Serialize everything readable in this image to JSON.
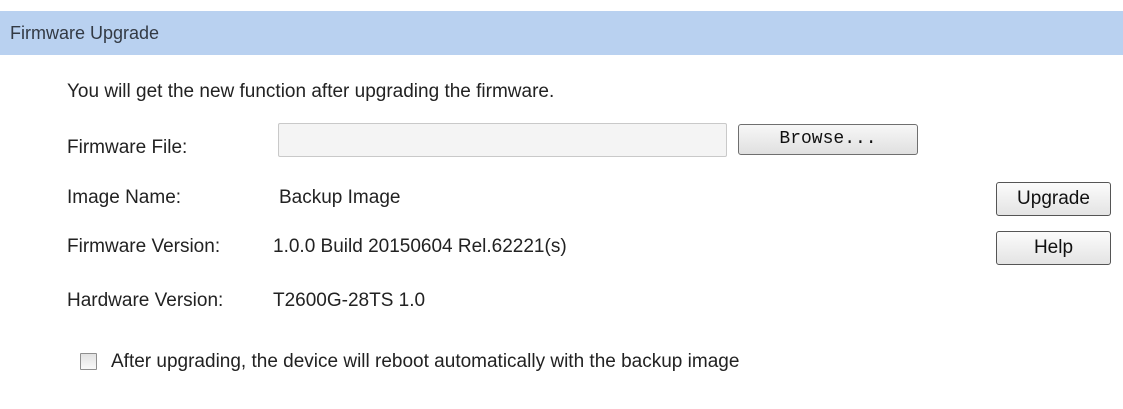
{
  "header": {
    "title": "Firmware Upgrade"
  },
  "form": {
    "intro": "You will get the new function after upgrading the firmware.",
    "firmware_file": {
      "label": "Firmware File:",
      "value": "",
      "browse_label": "Browse..."
    },
    "image_name": {
      "label": "Image Name:",
      "value": "Backup Image"
    },
    "firmware_version": {
      "label": "Firmware Version:",
      "value": "1.0.0 Build 20150604 Rel.62221(s)"
    },
    "hardware_version": {
      "label": "Hardware Version:",
      "value": "T2600G-28TS 1.0"
    },
    "reboot_option": {
      "label": "After upgrading, the device will reboot automatically with the backup image",
      "checked": false
    }
  },
  "actions": {
    "upgrade_label": "Upgrade",
    "help_label": "Help"
  },
  "colors": {
    "header_background": "#b9d1f0",
    "text": "#222222"
  }
}
